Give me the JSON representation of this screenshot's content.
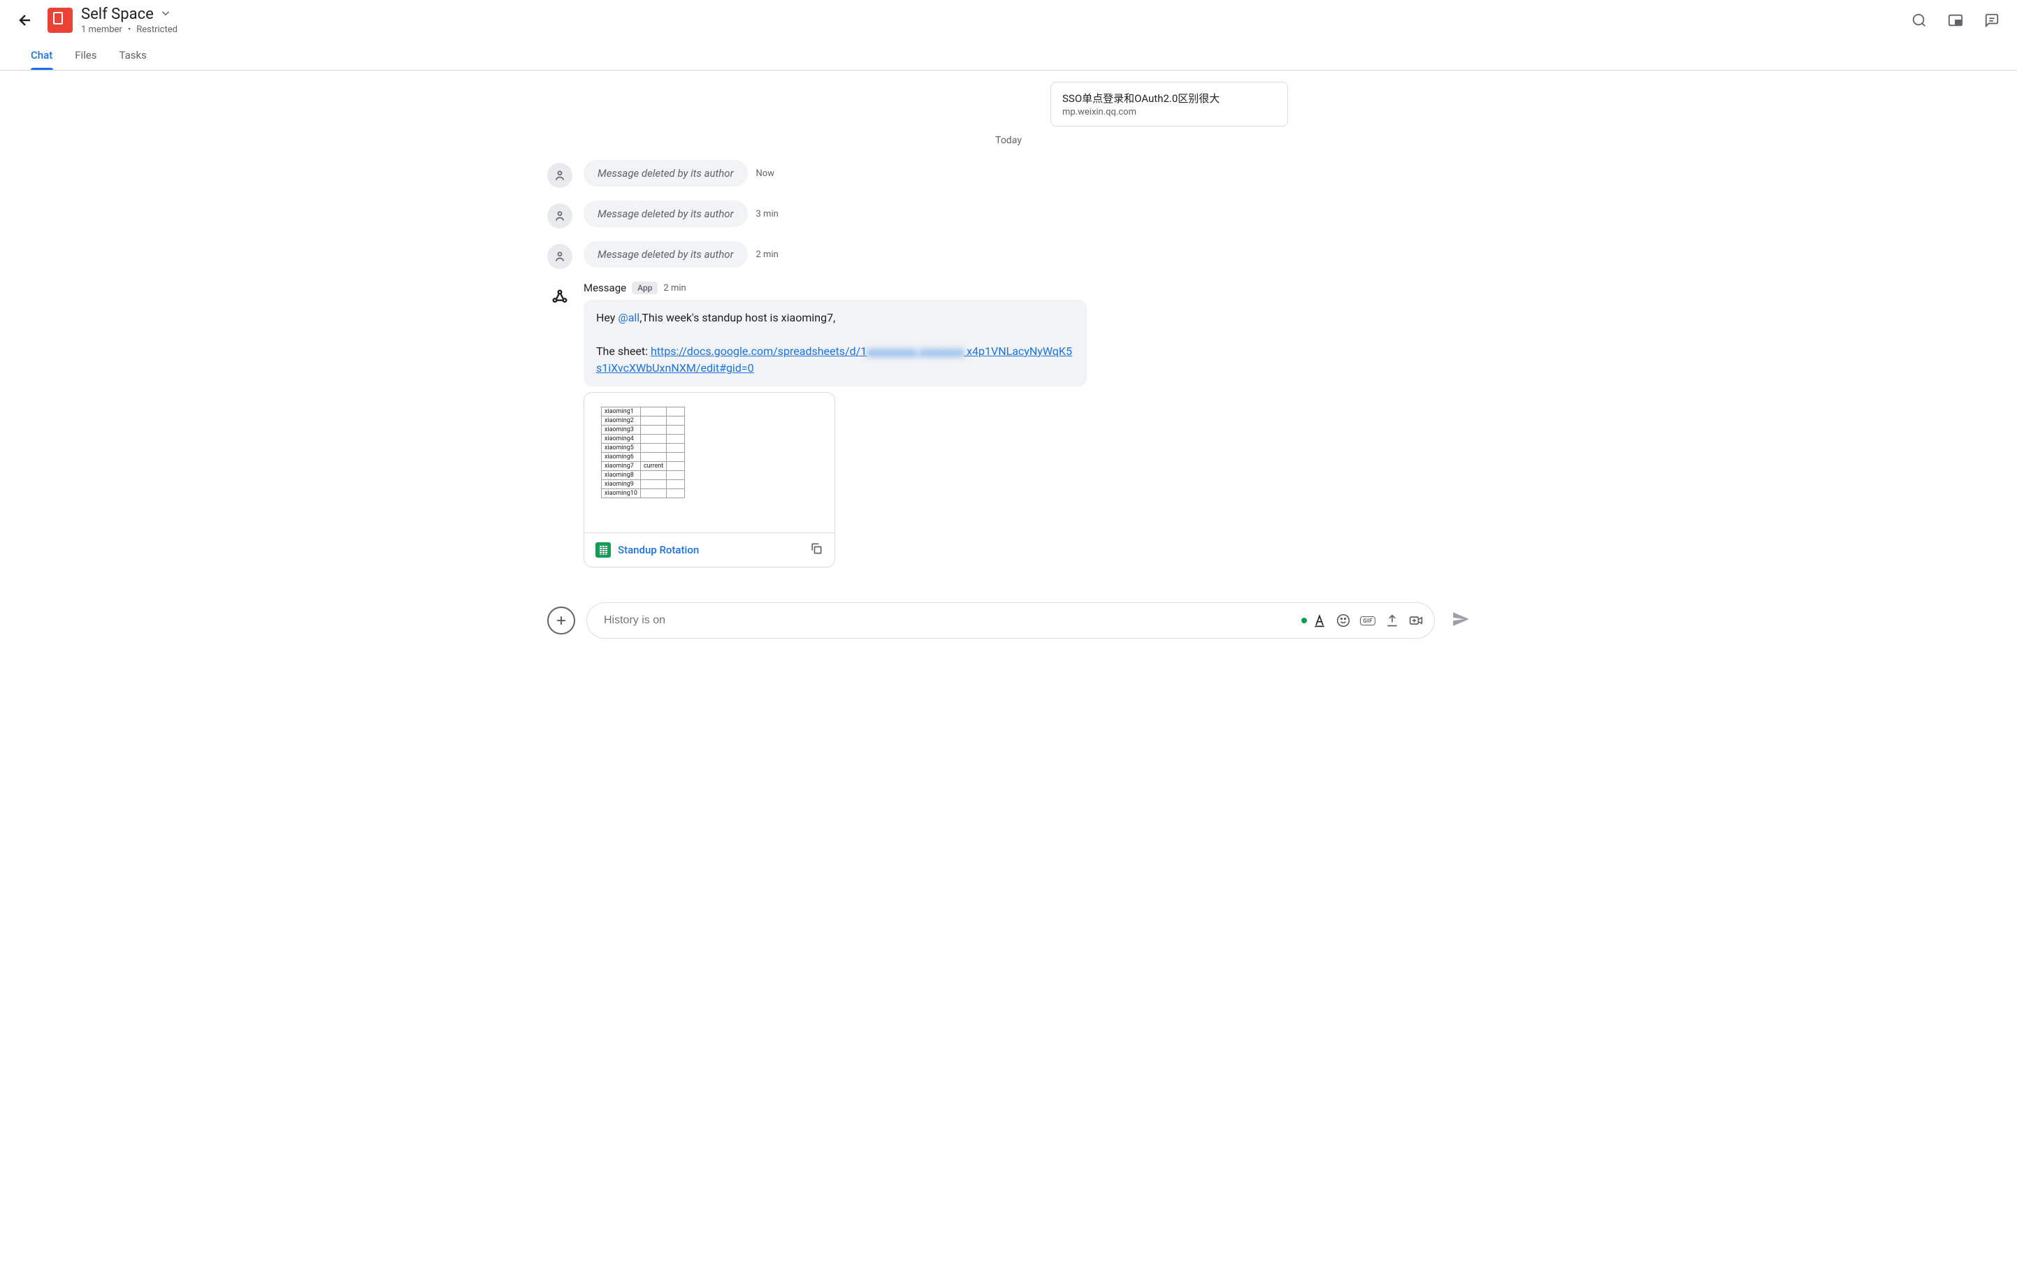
{
  "header": {
    "title": "Self Space",
    "members": "1 member",
    "separator": "•",
    "visibility": "Restricted"
  },
  "tabs": {
    "chat": "Chat",
    "files": "Files",
    "tasks": "Tasks"
  },
  "top_link_preview": {
    "title": "SSO单点登录和OAuth2.0区别很大",
    "domain": "mp.weixin.qq.com"
  },
  "date_divider": "Today",
  "messages": {
    "deleted_text": "Message deleted by its author",
    "times": {
      "m1": "Now",
      "m2": "3 min",
      "m3": "2 min"
    }
  },
  "app_message": {
    "sender": "Message",
    "badge": "App",
    "time": "2 min",
    "text_hey": "Hey ",
    "mention": "@all",
    "text_body": ",This week's standup host is xiaoming7,",
    "sheet_label": " The sheet: ",
    "url_part1": "https://docs.google.com/spreadsheets/d/1",
    "url_blur": "xxxxxxxxx xxxxxxxx",
    "url_part2": "x4p1VNLacyNyWqK5s1iXvcXWbUxnNXM/edit#gid=0"
  },
  "preview_table": {
    "rows": [
      {
        "name": "xiaoming1",
        "c2": "",
        "c3": ""
      },
      {
        "name": "xiaoming2",
        "c2": "",
        "c3": ""
      },
      {
        "name": "xiaoming3",
        "c2": "",
        "c3": ""
      },
      {
        "name": "xiaoming4",
        "c2": "",
        "c3": ""
      },
      {
        "name": "xiaoming5",
        "c2": "",
        "c3": ""
      },
      {
        "name": "xiaoming6",
        "c2": "",
        "c3": ""
      },
      {
        "name": "xiaoming7",
        "c2": "current",
        "c3": ""
      },
      {
        "name": "xiaoming8",
        "c2": "",
        "c3": ""
      },
      {
        "name": "xiaoming9",
        "c2": "",
        "c3": ""
      },
      {
        "name": "xiaoming10",
        "c2": "",
        "c3": ""
      }
    ]
  },
  "attachment": {
    "name": "Standup Rotation"
  },
  "composer": {
    "placeholder": "History is on",
    "gif_label": "GIF"
  }
}
